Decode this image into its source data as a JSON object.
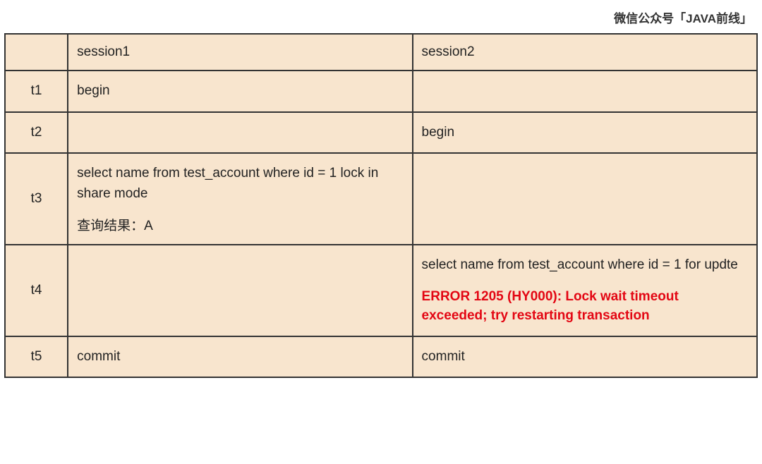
{
  "attribution": "微信公众号「JAVA前线」",
  "table": {
    "headers": {
      "time": "",
      "session1": "session1",
      "session2": "session2"
    },
    "rows": [
      {
        "time": "t1",
        "session1": {
          "main": "begin"
        },
        "session2": {
          "main": ""
        }
      },
      {
        "time": "t2",
        "session1": {
          "main": ""
        },
        "session2": {
          "main": "begin"
        }
      },
      {
        "time": "t3",
        "session1": {
          "main": "select name from test_account where id = 1 lock in share mode",
          "sub": "查询结果：A"
        },
        "session2": {
          "main": ""
        }
      },
      {
        "time": "t4",
        "session1": {
          "main": ""
        },
        "session2": {
          "main": "select name from test_account where id = 1 for updte",
          "error": "ERROR 1205 (HY000): Lock wait timeout exceeded; try restarting transaction"
        }
      },
      {
        "time": "t5",
        "session1": {
          "main": "commit"
        },
        "session2": {
          "main": "commit"
        }
      }
    ]
  }
}
